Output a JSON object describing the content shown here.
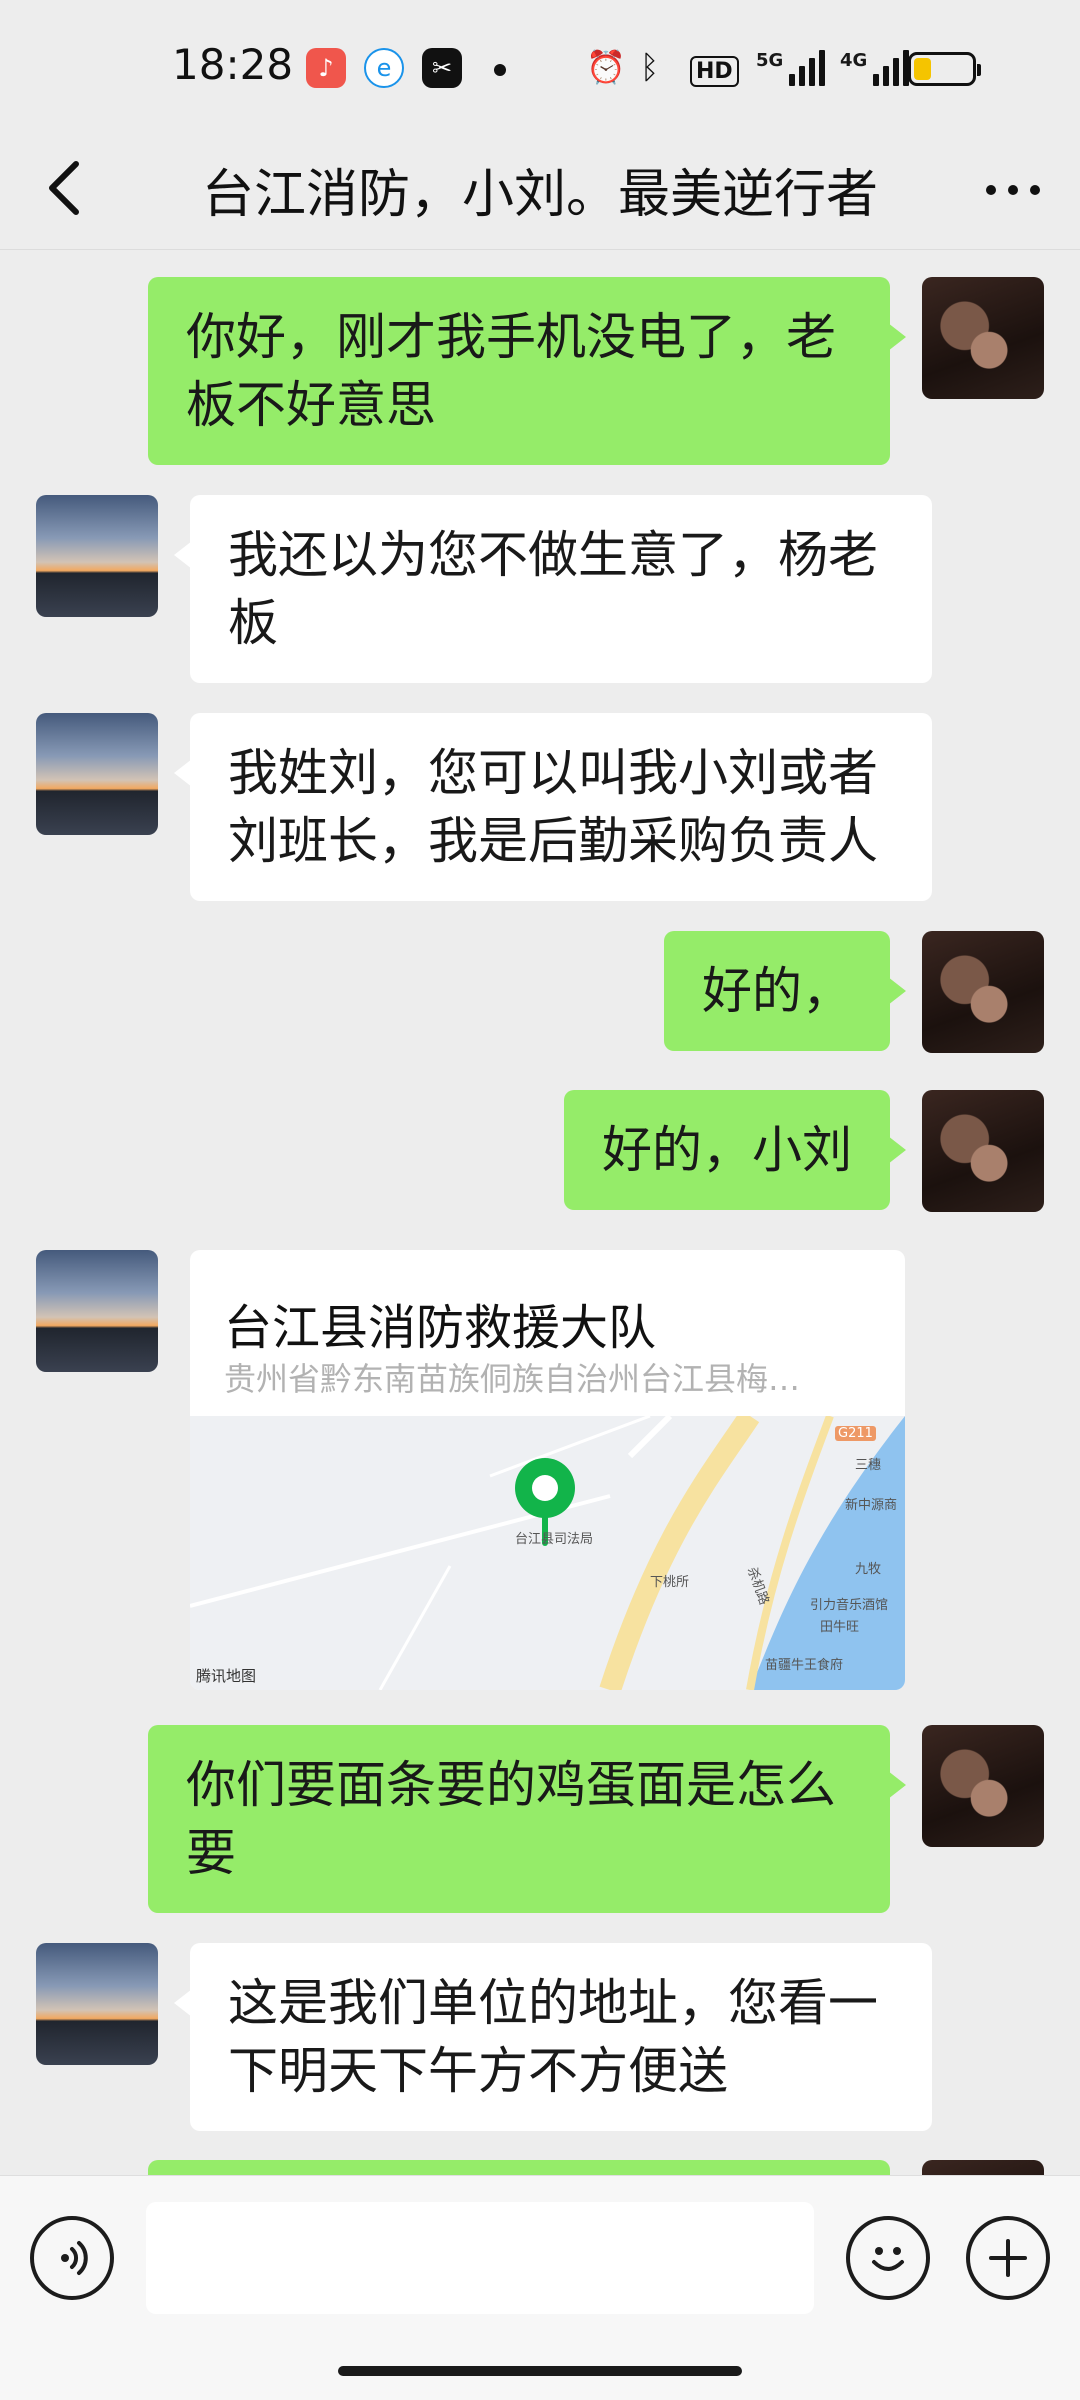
{
  "status_bar": {
    "time": "18:28",
    "network_5g": "5G",
    "network_4g": "4G",
    "hd_label": "HD",
    "app_icons": [
      "music-icon",
      "browser-icon",
      "capcut-icon"
    ],
    "battery_level": 0.3
  },
  "header": {
    "title": "台江消防，小刘。最美逆行者"
  },
  "messages": [
    {
      "sender": "me",
      "text": "你好，刚才我手机没电了，老板不好意思"
    },
    {
      "sender": "them",
      "text": "我还以为您不做生意了，杨老板"
    },
    {
      "sender": "them",
      "text": "我姓刘，您可以叫我小刘或者刘班长，我是后勤采购负责人"
    },
    {
      "sender": "me",
      "text": "好的，"
    },
    {
      "sender": "me",
      "text": "好的，小刘"
    },
    {
      "sender": "them",
      "type": "location",
      "name": "台江县消防救援大队",
      "address": "贵州省黔东南苗族侗族自治州台江县梅…"
    },
    {
      "sender": "me",
      "text": "你们要面条要的鸡蛋面是怎么要"
    },
    {
      "sender": "them",
      "text": "这是我们单位的地址，您看一下明天下午方不方便送"
    }
  ],
  "map": {
    "labels": [
      "台江县司法局",
      "下桃所",
      "三穗",
      "新中源商",
      "九牧",
      "引力音乐酒馆",
      "田牛旺",
      "苗疆牛王食府",
      "杀机路",
      "G211"
    ],
    "credit": "腾讯地图"
  },
  "colors": {
    "my_bubble": "#95ec69",
    "their_bubble": "#ffffff",
    "background": "#ededed",
    "pin": "#12b44a"
  }
}
